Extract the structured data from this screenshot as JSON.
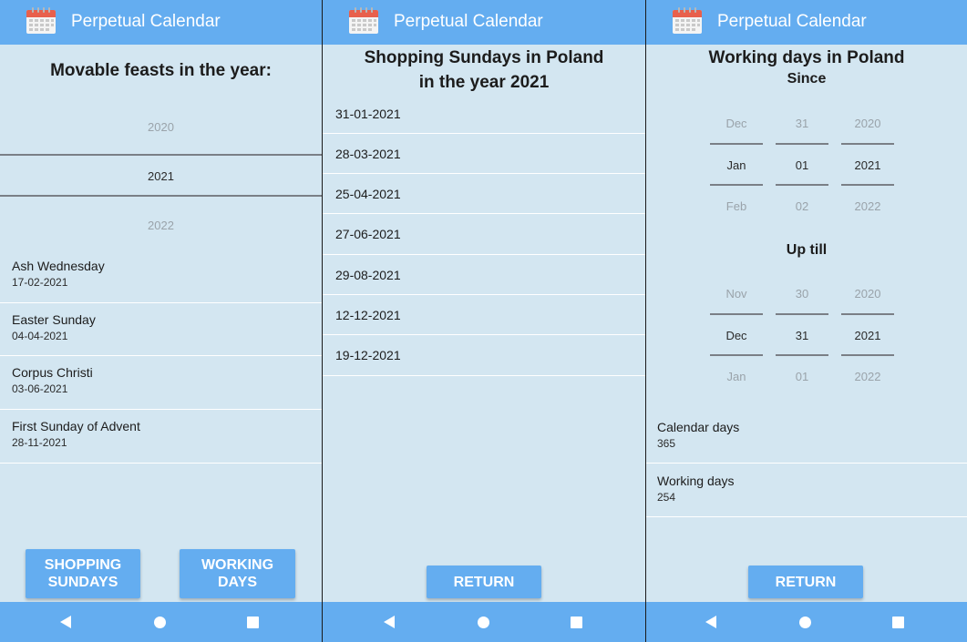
{
  "app": {
    "title": "Perpetual Calendar"
  },
  "colors": {
    "accent": "#64adf0",
    "background": "#d3e6f1",
    "divider": "#ffffff"
  },
  "screen1": {
    "heading": "Movable feasts in the year:",
    "year_picker": {
      "prev": "2020",
      "selected": "2021",
      "next": "2022"
    },
    "feasts": [
      {
        "name": "Ash Wednesday",
        "date": "17-02-2021"
      },
      {
        "name": "Easter Sunday",
        "date": "04-04-2021"
      },
      {
        "name": "Corpus Christi",
        "date": "03-06-2021"
      },
      {
        "name": "First Sunday of Advent",
        "date": "28-11-2021"
      }
    ],
    "buttons": {
      "shopping_line1": "SHOPPING",
      "shopping_line2": "SUNDAYS",
      "working_line1": "WORKING",
      "working_line2": "DAYS"
    }
  },
  "screen2": {
    "heading_line1": "Shopping Sundays in Poland",
    "heading_line2": "in the year 2021",
    "dates": [
      "31-01-2021",
      "28-03-2021",
      "25-04-2021",
      "27-06-2021",
      "29-08-2021",
      "12-12-2021",
      "19-12-2021"
    ],
    "return_label": "RETURN"
  },
  "screen3": {
    "heading": "Working days in Poland",
    "since_label": "Since",
    "since_picker": {
      "month": {
        "prev": "Dec",
        "selected": "Jan",
        "next": "Feb"
      },
      "day": {
        "prev": "31",
        "selected": "01",
        "next": "02"
      },
      "year": {
        "prev": "2020",
        "selected": "2021",
        "next": "2022"
      }
    },
    "until_label": "Up till",
    "until_picker": {
      "month": {
        "prev": "Nov",
        "selected": "Dec",
        "next": "Jan"
      },
      "day": {
        "prev": "30",
        "selected": "31",
        "next": "01"
      },
      "year": {
        "prev": "2020",
        "selected": "2021",
        "next": "2022"
      }
    },
    "results": [
      {
        "label": "Calendar days",
        "value": "365"
      },
      {
        "label": "Working days",
        "value": "254"
      }
    ],
    "return_label": "RETURN"
  },
  "icons": {
    "app": "calendar-icon",
    "back": "back-triangle-icon",
    "home": "home-circle-icon",
    "recent": "recent-apps-square-icon"
  }
}
